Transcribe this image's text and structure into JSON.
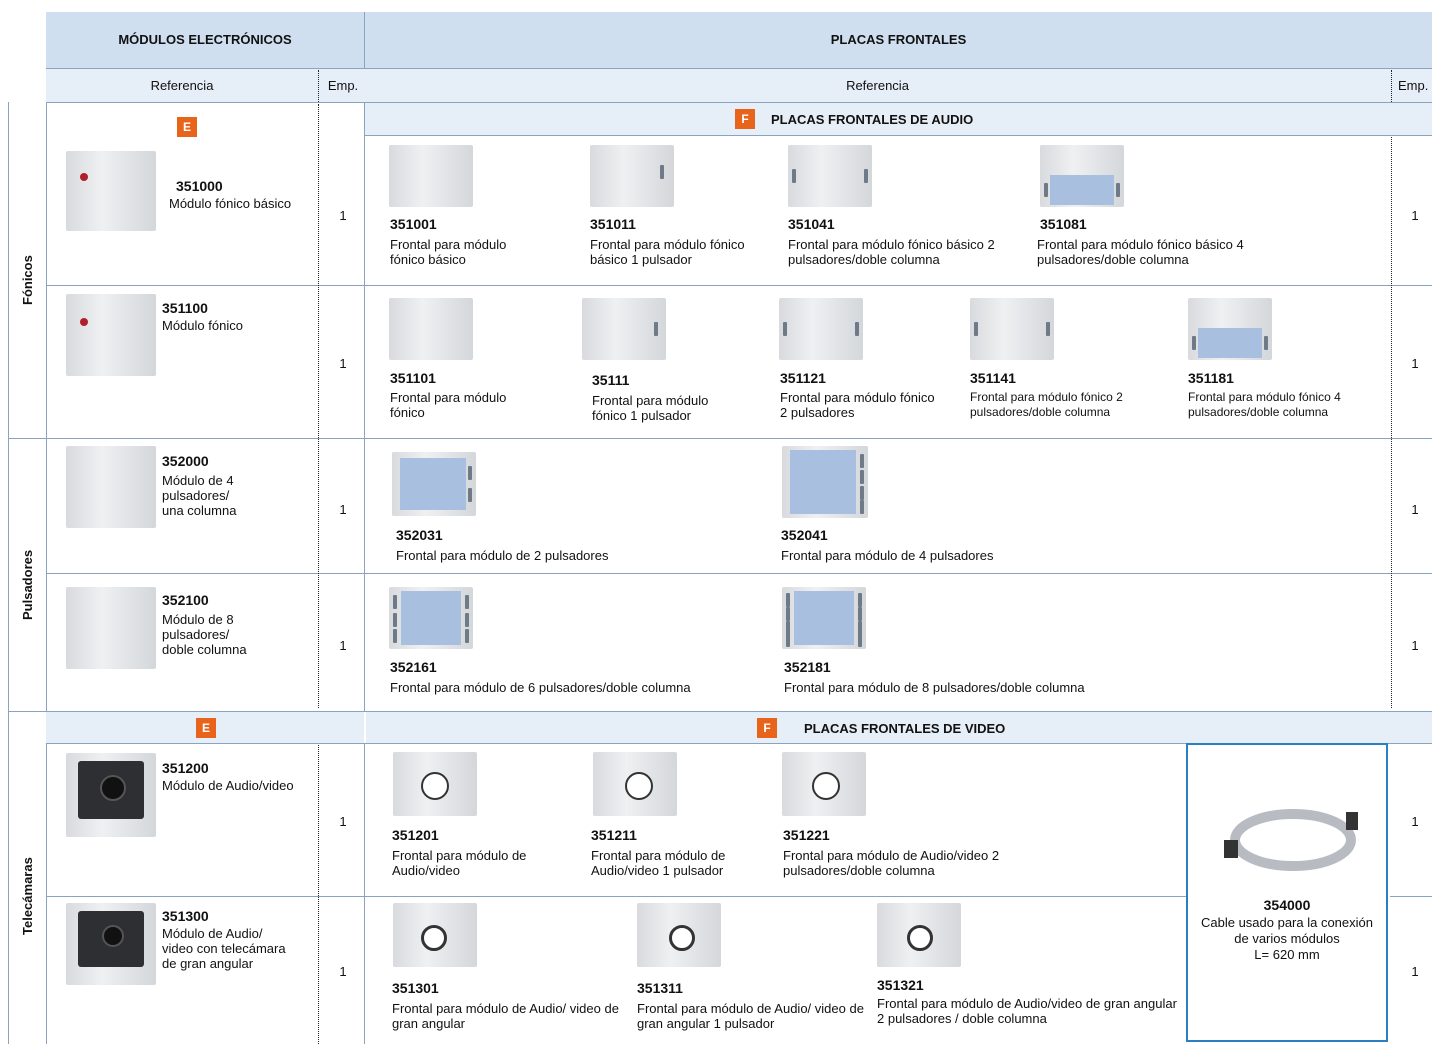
{
  "header": {
    "modulos_title": "MÓDULOS ELECTRÓNICOS",
    "placas_title": "PLACAS FRONTALES",
    "referencia_left": "Referencia",
    "emp_left": "Emp.",
    "referencia_right": "Referencia",
    "emp_right": "Emp."
  },
  "sections": {
    "tag_e": "E",
    "tag_f": "F",
    "audio_title": "PLACAS FRONTALES DE AUDIO",
    "video_title": "PLACAS FRONTALES DE VIDEO"
  },
  "groups": {
    "fonicos": "Fónicos",
    "pulsadores": "Pulsadores",
    "telecamaras": "Telecámaras"
  },
  "rows": [
    {
      "module_code": "351000",
      "module_desc": "Módulo fónico básico",
      "emp_left": "1",
      "emp_right": "1",
      "plates": [
        {
          "code": "351001",
          "desc": "Frontal para módulo fónico básico"
        },
        {
          "code": "351011",
          "desc": "Frontal para módulo fónico básico 1 pulsador"
        },
        {
          "code": "351041",
          "desc": "Frontal para módulo fónico básico 2 pulsadores/doble columna"
        },
        {
          "code": "351081",
          "desc": "Frontal para módulo fónico básico 4 pulsadores/doble columna"
        }
      ]
    },
    {
      "module_code": "351100",
      "module_desc": "Módulo fónico",
      "emp_left": "1",
      "emp_right": "1",
      "plates": [
        {
          "code": "351101",
          "desc": "Frontal para módulo fónico"
        },
        {
          "code": "35111",
          "desc": "Frontal para módulo fónico 1 pulsador"
        },
        {
          "code": "351121",
          "desc": "Frontal para módulo fónico 2 pulsadores"
        },
        {
          "code": "351141",
          "desc": "Frontal para módulo fónico 2 pulsadores/doble columna"
        },
        {
          "code": "351181",
          "desc": "Frontal para módulo fónico 4 pulsadores/doble columna"
        }
      ]
    },
    {
      "module_code": "352000",
      "module_desc": "Módulo de 4 pulsadores/ una columna",
      "emp_left": "1",
      "emp_right": "1",
      "plates": [
        {
          "code": "352031",
          "desc": "Frontal para módulo de 2 pulsadores"
        },
        {
          "code": "352041",
          "desc": "Frontal para módulo de 4 pulsadores"
        }
      ]
    },
    {
      "module_code": "352100",
      "module_desc": "Módulo de 8 pulsadores/ doble columna",
      "emp_left": "1",
      "emp_right": "1",
      "plates": [
        {
          "code": "352161",
          "desc": "Frontal para módulo de 6 pulsadores/doble columna"
        },
        {
          "code": "352181",
          "desc": "Frontal para módulo de 8 pulsadores/doble columna"
        }
      ]
    },
    {
      "module_code": "351200",
      "module_desc": "Módulo de Audio/video",
      "emp_left": "1",
      "emp_right": "1",
      "plates": [
        {
          "code": "351201",
          "desc": "Frontal para módulo de Audio/video"
        },
        {
          "code": "351211",
          "desc": "Frontal para módulo de Audio/video 1 pulsador"
        },
        {
          "code": "351221",
          "desc": "Frontal para módulo de Audio/video 2 pulsadores/doble columna"
        }
      ]
    },
    {
      "module_code": "351300",
      "module_desc": "Módulo de Audio/ video con telecámara de gran angular",
      "emp_left": "1",
      "emp_right": "1",
      "plates": [
        {
          "code": "351301",
          "desc": "Frontal para módulo de Audio/ video de gran angular"
        },
        {
          "code": "351311",
          "desc": "Frontal para módulo de Audio/ video de gran angular 1 pulsador"
        },
        {
          "code": "351321",
          "desc": "Frontal para módulo de Audio/video de gran angular 2 pulsadores / doble columna"
        }
      ]
    }
  ],
  "cable": {
    "code": "354000",
    "desc1": "Cable usado para la conexión",
    "desc2": "de varios módulos",
    "length": "L= 620 mm"
  }
}
